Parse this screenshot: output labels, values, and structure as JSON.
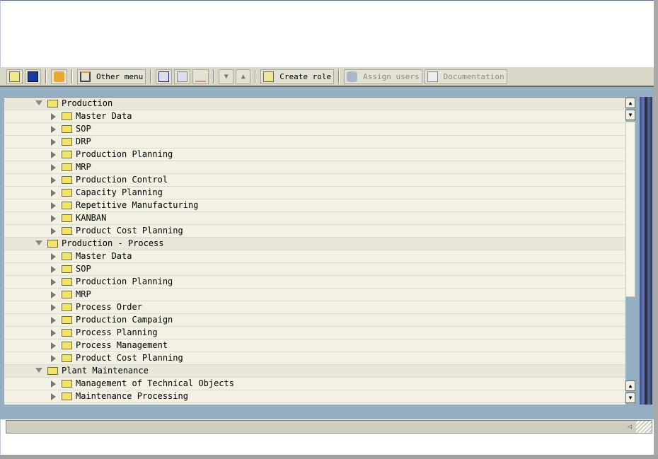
{
  "toolbar": {
    "other_menu": "Other menu",
    "create_role": "Create role",
    "assign_users": "Assign users",
    "documentation": "Documentation"
  },
  "tree": [
    {
      "label": "Production",
      "level": 0,
      "expanded": true
    },
    {
      "label": "Master Data",
      "level": 1
    },
    {
      "label": "SOP",
      "level": 1
    },
    {
      "label": "DRP",
      "level": 1
    },
    {
      "label": "Production Planning",
      "level": 1
    },
    {
      "label": "MRP",
      "level": 1
    },
    {
      "label": "Production Control",
      "level": 1
    },
    {
      "label": "Capacity Planning",
      "level": 1
    },
    {
      "label": "Repetitive Manufacturing",
      "level": 1
    },
    {
      "label": "KANBAN",
      "level": 1
    },
    {
      "label": "Product Cost Planning",
      "level": 1
    },
    {
      "label": "Production - Process",
      "level": 0,
      "expanded": true
    },
    {
      "label": "Master Data",
      "level": 1
    },
    {
      "label": "SOP",
      "level": 1
    },
    {
      "label": "Production Planning",
      "level": 1
    },
    {
      "label": "MRP",
      "level": 1
    },
    {
      "label": "Process Order",
      "level": 1
    },
    {
      "label": "Production Campaign",
      "level": 1
    },
    {
      "label": "Process Planning",
      "level": 1
    },
    {
      "label": "Process Management",
      "level": 1
    },
    {
      "label": "Product Cost Planning",
      "level": 1
    },
    {
      "label": "Plant Maintenance",
      "level": 0,
      "expanded": true
    },
    {
      "label": "Management of Technical Objects",
      "level": 1
    },
    {
      "label": "Maintenance Processing",
      "level": 1
    }
  ],
  "colors": {
    "toolbar": "#d9d7c8",
    "background": "#94afc2",
    "tree": "#f3f1e3",
    "folder": "#f2e36a"
  }
}
